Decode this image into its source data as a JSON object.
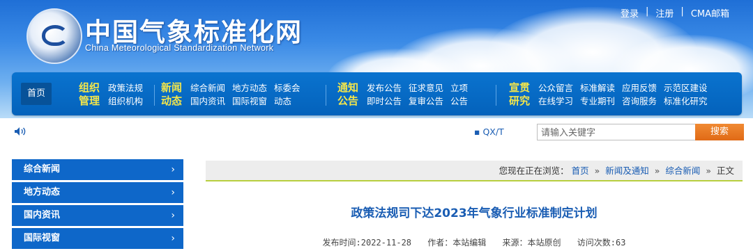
{
  "header": {
    "site_title": "中国气象标准化网",
    "site_subtitle": "China Meteorological Standardization Network",
    "top_links": [
      "登录",
      "注册",
      "CMA邮箱"
    ],
    "top_sep": "|"
  },
  "nav": {
    "home": "首页",
    "groups": [
      {
        "label": [
          "组织",
          "管理"
        ],
        "rows": [
          [
            "政策法规"
          ],
          [
            "组织机构"
          ]
        ]
      },
      {
        "label": [
          "新闻",
          "动态"
        ],
        "rows": [
          [
            "综合新闻",
            "地方动态",
            "标委会"
          ],
          [
            "国内资讯",
            "国际视窗",
            "动态"
          ]
        ]
      },
      {
        "label": [
          "通知",
          "公告"
        ],
        "rows": [
          [
            "发布公告",
            "征求意见",
            "立项"
          ],
          [
            "即时公告",
            "复审公告",
            "公告"
          ]
        ]
      },
      {
        "label": [
          "宣贯",
          "研究"
        ],
        "rows": [
          [
            "公众留言",
            "标准解读",
            "应用反馈",
            "示范区建设"
          ],
          [
            "在线学习",
            "专业期刊",
            "咨询服务",
            "标准化研究"
          ]
        ]
      }
    ]
  },
  "util": {
    "speaker_icon": "speaker-icon",
    "qx_link": "QX/T",
    "search_placeholder": "请输入关键字",
    "search_button": "搜索"
  },
  "sidebar": {
    "items": [
      "综合新闻",
      "地方动态",
      "国内资讯",
      "国际视窗"
    ],
    "chevron": "›"
  },
  "breadcrumb": {
    "prefix": "您现在正在浏览：",
    "items": [
      "首页",
      "新闻及通知",
      "综合新闻",
      "正文"
    ],
    "sep": "»"
  },
  "article": {
    "title": "政策法规司下达2023年气象行业标准制定计划",
    "publish_time": "发布时间:2022-11-28",
    "author": "作者：本站编辑",
    "source": "来源：本站原创",
    "visits": "访问次数:63"
  },
  "colors": {
    "nav_bg": "#0462bb",
    "nav_label": "#f4e64a",
    "sidebar_bg": "#0e67c9",
    "title_blue": "#1a5db3",
    "search_orange": "#e06a16",
    "breadcrumb_border": "#b8cf3e"
  }
}
